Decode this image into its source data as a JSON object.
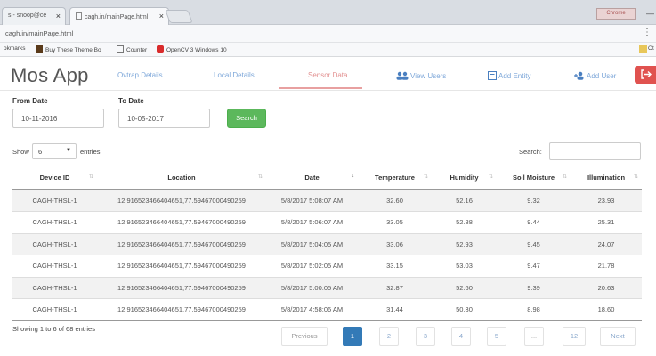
{
  "browser": {
    "tabs": [
      {
        "label": "s - snoop@ce"
      },
      {
        "label": "cagh.in/mainPage.html"
      }
    ],
    "user_button": "Chrome",
    "url": "cagh.in/mainPage.html",
    "bookmarks": [
      {
        "label": "okmarks"
      },
      {
        "label": "Buy These Theme Bo"
      },
      {
        "label": "Counter"
      },
      {
        "label": "OpenCV 3 Windows 10"
      }
    ],
    "bookmarks_other": "Ot"
  },
  "app": {
    "logo": "Mos App",
    "nav": [
      {
        "label": "Ovtrap Details"
      },
      {
        "label": "Local Details"
      },
      {
        "label": "Sensor Data"
      },
      {
        "label": "View Users"
      },
      {
        "label": "Add Entity"
      },
      {
        "label": "Add User"
      }
    ],
    "active_nav": "Sensor Data",
    "logout_icon": "logout-icon"
  },
  "filters": {
    "from_label": "From Date",
    "from_value": "10-11-2016",
    "to_label": "To Date",
    "to_value": "10-05-2017",
    "search_button": "Search"
  },
  "table_controls": {
    "show_label": "Show",
    "page_size": "6",
    "entries_label": "entries",
    "search_label": "Search:",
    "search_value": ""
  },
  "table": {
    "columns": [
      "Device ID",
      "Location",
      "Date",
      "Temperature",
      "Humidity",
      "Soil Moisture",
      "Illumination"
    ],
    "rows": [
      [
        "CAGH-THSL-1",
        "12.916523466404651,77.59467000490259",
        "5/8/2017 5:08:07 AM",
        "32.60",
        "52.16",
        "9.32",
        "23.93"
      ],
      [
        "CAGH-THSL-1",
        "12.916523466404651,77.59467000490259",
        "5/8/2017 5:06:07 AM",
        "33.05",
        "52.88",
        "9.44",
        "25.31"
      ],
      [
        "CAGH-THSL-1",
        "12.916523466404651,77.59467000490259",
        "5/8/2017 5:04:05 AM",
        "33.06",
        "52.93",
        "9.45",
        "24.07"
      ],
      [
        "CAGH-THSL-1",
        "12.916523466404651,77.59467000490259",
        "5/8/2017 5:02:05 AM",
        "33.15",
        "53.03",
        "9.47",
        "21.78"
      ],
      [
        "CAGH-THSL-1",
        "12.916523466404651,77.59467000490259",
        "5/8/2017 5:00:05 AM",
        "32.87",
        "52.60",
        "9.39",
        "20.63"
      ],
      [
        "CAGH-THSL-1",
        "12.916523466404651,77.59467000490259",
        "5/8/2017 4:58:06 AM",
        "31.44",
        "50.30",
        "8.98",
        "18.60"
      ]
    ]
  },
  "footer": {
    "info": "Showing 1 to 6 of 68 entries",
    "previous": "Previous",
    "pages": [
      "1",
      "2",
      "3",
      "4",
      "5",
      "...",
      "12"
    ],
    "next": "Next"
  },
  "colors": {
    "primary": "#337ab7",
    "success": "#5cb85c",
    "danger": "#e0524f",
    "nav_link": "#7da7d9",
    "nav_active": "#e28f8f"
  }
}
